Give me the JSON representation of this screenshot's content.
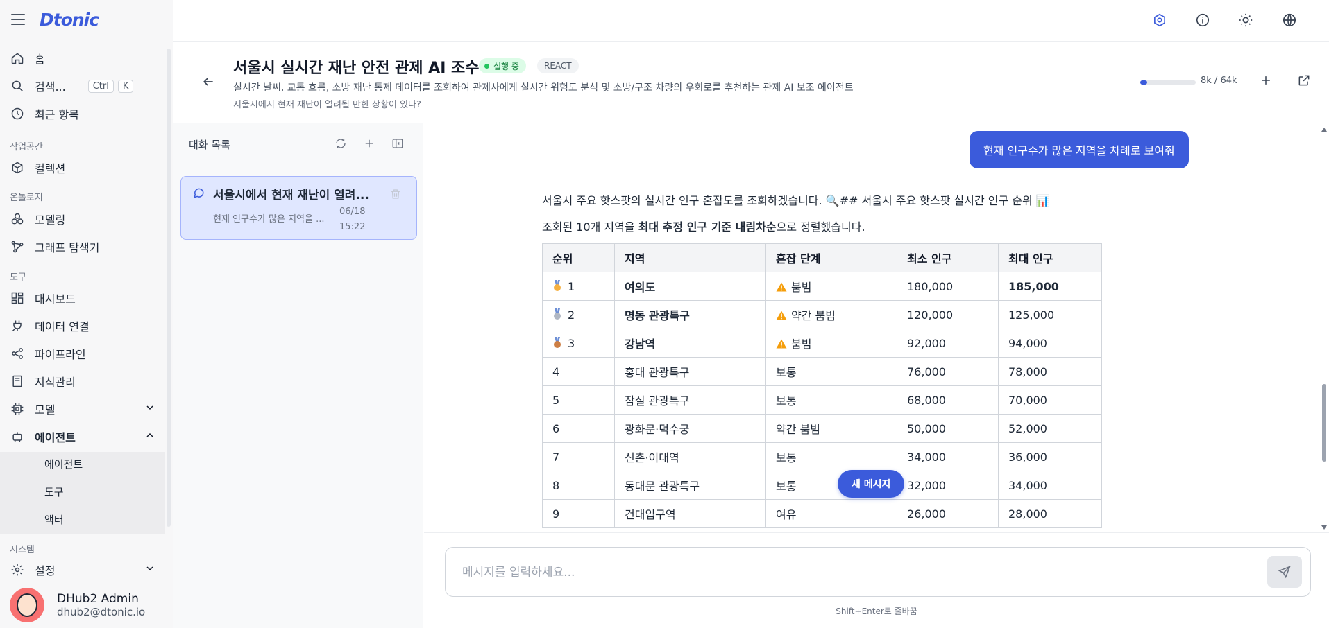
{
  "brand": {
    "logo": "Dtonic",
    "accent": "#3b5bdb"
  },
  "sidebar": {
    "top_items": [
      {
        "label": "홈",
        "icon": "home-icon"
      },
      {
        "label": "검색...",
        "icon": "search-icon",
        "shortcut": [
          "Ctrl",
          "K"
        ]
      },
      {
        "label": "최근 항목",
        "icon": "clock-icon"
      }
    ],
    "sections": {
      "workspace": "작업공간",
      "ontology": "온톨로지",
      "tools": "도구",
      "system": "시스템"
    },
    "workspace_items": [
      {
        "label": "컬렉션",
        "icon": "cube-icon"
      }
    ],
    "ontology_items": [
      {
        "label": "모델링",
        "icon": "circles-icon"
      },
      {
        "label": "그래프 탐색기",
        "icon": "graph-icon"
      }
    ],
    "tool_items": [
      {
        "label": "대시보드",
        "icon": "dashboard-icon"
      },
      {
        "label": "데이터 연결",
        "icon": "plug-icon"
      },
      {
        "label": "파이프라인",
        "icon": "share-icon"
      },
      {
        "label": "지식관리",
        "icon": "book-icon"
      },
      {
        "label": "모델",
        "icon": "chip-icon"
      },
      {
        "label": "에이전트",
        "icon": "bot-icon"
      }
    ],
    "agent_subitems": [
      "에이전트",
      "도구",
      "액터"
    ],
    "system_items": [
      {
        "label": "설정",
        "icon": "gear-icon"
      }
    ],
    "user": {
      "name": "DHub2 Admin",
      "email": "dhub2@dtonic.io"
    }
  },
  "topbar": {
    "icons": [
      "agent-status-icon",
      "info-icon",
      "sun-icon",
      "globe-icon"
    ]
  },
  "header": {
    "title": "서울시 실시간 재난 안전 관제 AI 조수",
    "status_badge": "실행 중",
    "type_badge": "REACT",
    "description": "실시간 날씨, 교통 흐름, 소방 재난 통제 데이터를 조회하여 관제사에게 실시간 위험도 분석 및 소방/구조 차량의 우회로를 추천하는 관제 AI 보조 에이전트",
    "subtitle": "서울시에서 현재 재난이 열려될 만한 상황이 있나?",
    "token_usage": "8k / 64k",
    "token_fraction": 0.125
  },
  "conversations": {
    "title": "대화 목록",
    "items": [
      {
        "title": "서울시에서 현재 재난이 열려...",
        "preview": "현재 인구수가 많은 지역을 ...",
        "date": "06/18",
        "time": "15:22"
      }
    ]
  },
  "chat": {
    "user_message": "현재 인구수가 많은 지역을 차례로 보여줘",
    "ai_intro": "서울시 주요 핫스팟의 실시간 인구 혼잡도를 조회하겠습니다. 🔍## 서울시 주요 핫스팟 실시간 인구 순위 📊",
    "ai_summary_prefix": "조회된 10개 지역을 ",
    "ai_summary_bold": "최대 추정 인구 기준 내림차순",
    "ai_summary_suffix": "으로 정렬했습니다.",
    "table": {
      "headers": [
        "순위",
        "지역",
        "혼잡 단계",
        "최소 인구",
        "최대 인구"
      ],
      "rows": [
        {
          "rank": "1",
          "medal": "gold",
          "region": "여의도",
          "level": "붐빔",
          "warn": true,
          "min": "180,000",
          "max": "185,000",
          "bold": true,
          "max_bold": true
        },
        {
          "rank": "2",
          "medal": "silver",
          "region": "명동 관광특구",
          "level": "약간 붐빔",
          "warn": true,
          "min": "120,000",
          "max": "125,000",
          "bold": true,
          "max_bold": false
        },
        {
          "rank": "3",
          "medal": "bronze",
          "region": "강남역",
          "level": "붐빔",
          "warn": true,
          "min": "92,000",
          "max": "94,000",
          "bold": true,
          "max_bold": false
        },
        {
          "rank": "4",
          "medal": "",
          "region": "홍대 관광특구",
          "level": "보통",
          "warn": false,
          "min": "76,000",
          "max": "78,000",
          "bold": false,
          "max_bold": false
        },
        {
          "rank": "5",
          "medal": "",
          "region": "잠실 관광특구",
          "level": "보통",
          "warn": false,
          "min": "68,000",
          "max": "70,000",
          "bold": false,
          "max_bold": false
        },
        {
          "rank": "6",
          "medal": "",
          "region": "광화문·덕수궁",
          "level": "약간 붐빔",
          "warn": false,
          "min": "50,000",
          "max": "52,000",
          "bold": false,
          "max_bold": false
        },
        {
          "rank": "7",
          "medal": "",
          "region": "신촌·이대역",
          "level": "보통",
          "warn": false,
          "min": "34,000",
          "max": "36,000",
          "bold": false,
          "max_bold": false
        },
        {
          "rank": "8",
          "medal": "",
          "region": "동대문 관광특구",
          "level": "보통",
          "warn": false,
          "min": "32,000",
          "max": "34,000",
          "bold": false,
          "max_bold": false
        },
        {
          "rank": "9",
          "medal": "",
          "region": "건대입구역",
          "level": "여유",
          "warn": false,
          "min": "26,000",
          "max": "28,000",
          "bold": false,
          "max_bold": false
        }
      ]
    },
    "new_message_button": "새 메시지"
  },
  "composer": {
    "placeholder": "메시지를 입력하세요...",
    "value": "",
    "hint": "Shift+Enter로 줄바꿈"
  }
}
